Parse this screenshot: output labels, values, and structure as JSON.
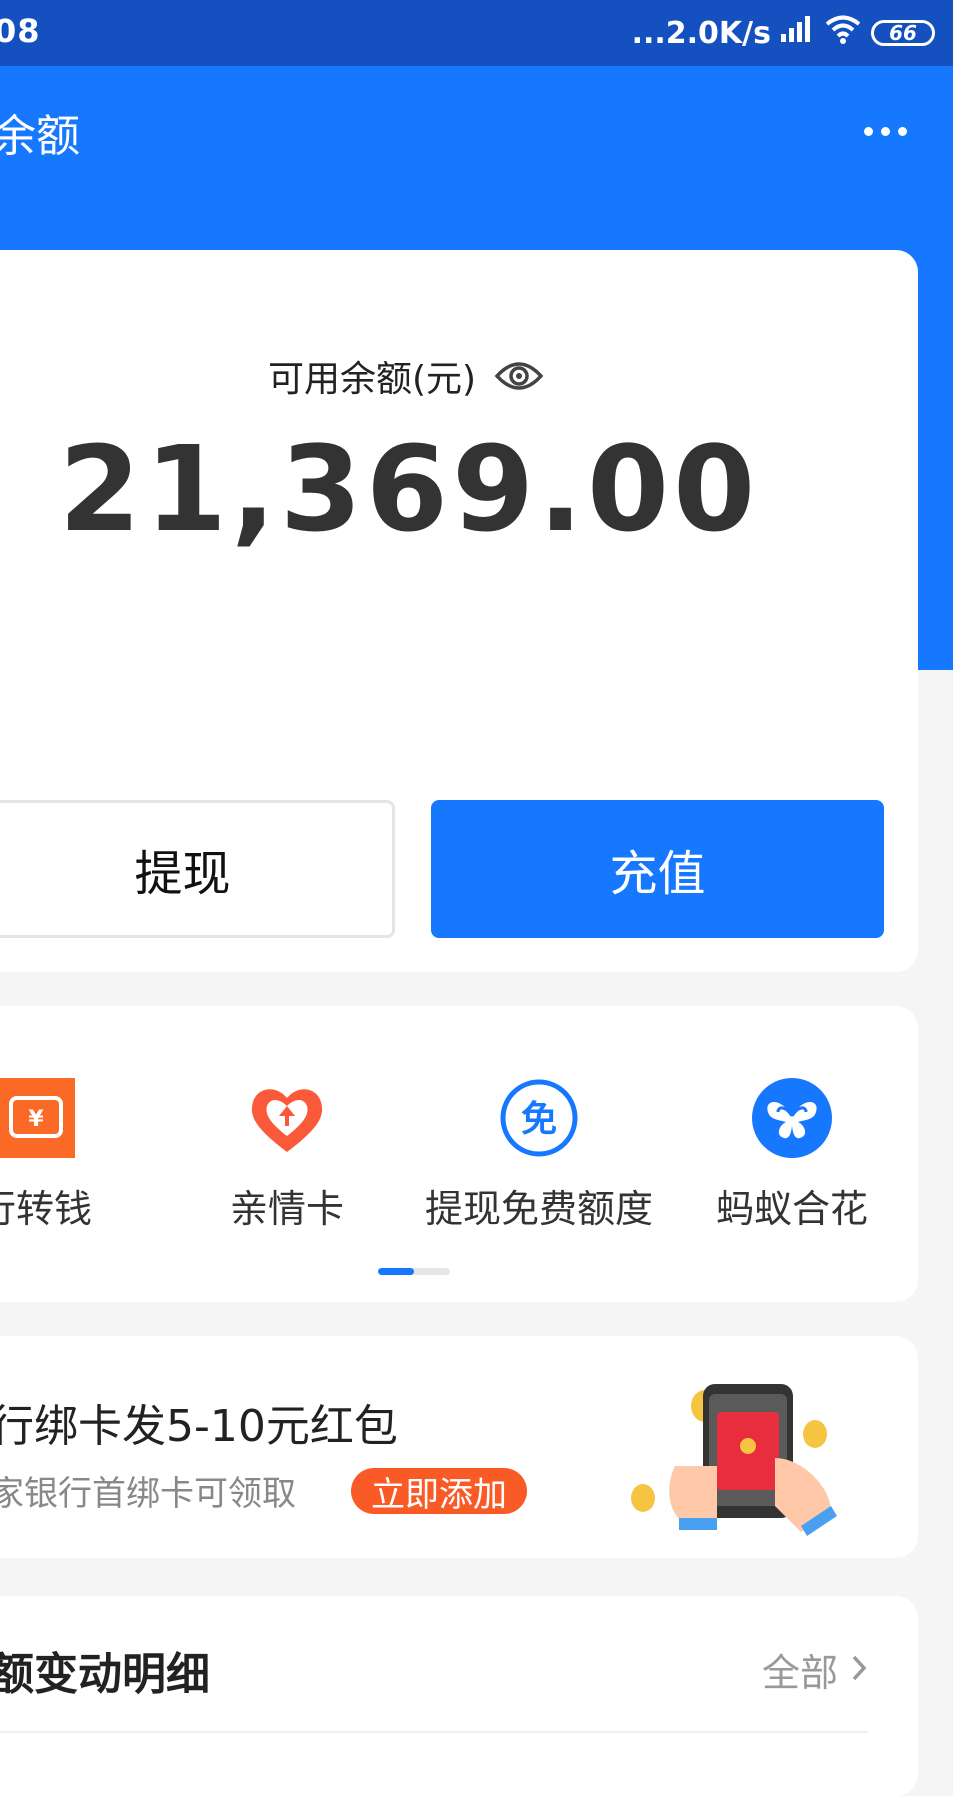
{
  "status_bar": {
    "time": "08",
    "network_speed": "...2.0K/s",
    "battery_level": "66"
  },
  "header": {
    "title": "余额"
  },
  "balance": {
    "label": "可用余额(元)",
    "amount": "21,369.00",
    "withdraw_label": "提现",
    "topup_label": "充值"
  },
  "shortcuts": [
    {
      "label": "行转钱",
      "icon": "transfer-icon"
    },
    {
      "label": "亲情卡",
      "icon": "heart-card-icon"
    },
    {
      "label": "提现免费额度",
      "icon": "free-badge-icon"
    },
    {
      "label": "蚂蚁合花",
      "icon": "butterfly-icon"
    }
  ],
  "shortcut_icon_text": {
    "free": "免",
    "yuan": "¥"
  },
  "promo": {
    "title": "行绑卡发5-10元红包",
    "subtitle": "家银行首绑卡可领取",
    "action_label": "立即添加"
  },
  "details": {
    "title": "额变动明细",
    "all_label": "全部"
  },
  "colors": {
    "primary": "#1677ff",
    "status_bar": "#1450c0",
    "orange": "#fa5a26"
  }
}
